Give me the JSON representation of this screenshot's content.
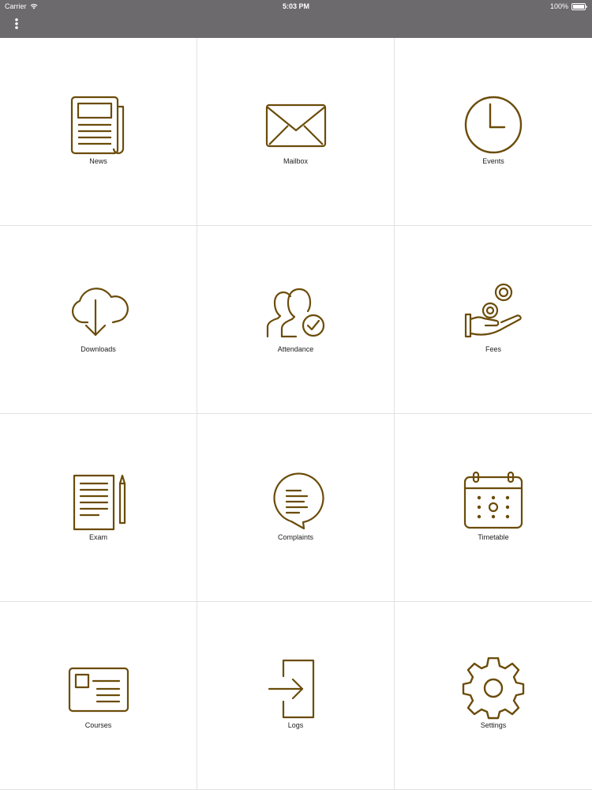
{
  "status": {
    "carrier": "Carrier",
    "time": "5:03 PM",
    "battery": "100%"
  },
  "accent_color": "#6b4c0a",
  "tiles": [
    {
      "label": "News",
      "icon": "newspaper-icon"
    },
    {
      "label": "Mailbox",
      "icon": "envelope-icon"
    },
    {
      "label": "Events",
      "icon": "clock-icon"
    },
    {
      "label": "Downloads",
      "icon": "cloud-download-icon"
    },
    {
      "label": "Attendance",
      "icon": "users-check-icon"
    },
    {
      "label": "Fees",
      "icon": "hand-coins-icon"
    },
    {
      "label": "Exam",
      "icon": "exam-paper-pencil-icon"
    },
    {
      "label": "Complaints",
      "icon": "speech-bubble-icon"
    },
    {
      "label": "Timetable",
      "icon": "calendar-icon"
    },
    {
      "label": "Courses",
      "icon": "id-card-icon"
    },
    {
      "label": "Logs",
      "icon": "login-door-icon"
    },
    {
      "label": "Settings",
      "icon": "gear-icon"
    }
  ]
}
